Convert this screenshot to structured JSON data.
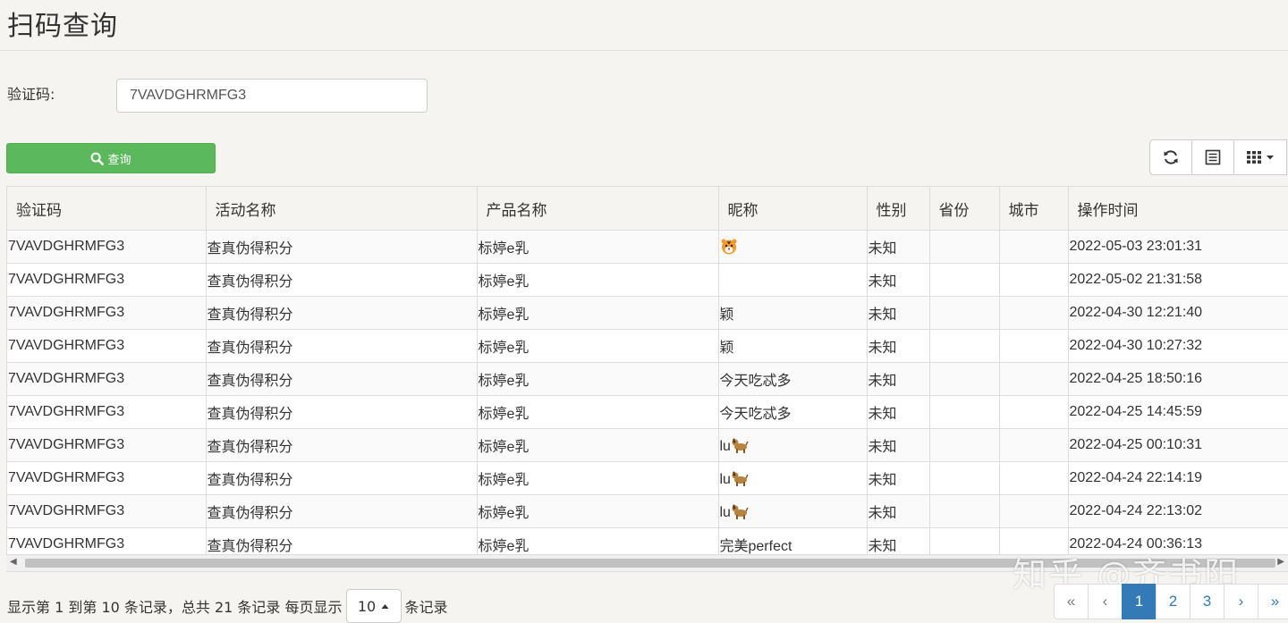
{
  "page": {
    "title": "扫码查询"
  },
  "search": {
    "label": "验证码:",
    "value": "7VAVDGHRMFG3",
    "button_label": "查询"
  },
  "toolbar": {
    "refresh_icon": "refresh-icon",
    "list_icon": "list-icon",
    "columns_icon": "columns-grid-icon"
  },
  "table": {
    "headers": [
      "验证码",
      "活动名称",
      "产品名称",
      "昵称",
      "性别",
      "省份",
      "城市",
      "操作时间"
    ],
    "rows": [
      {
        "code": "7VAVDGHRMFG3",
        "activity": "查真伪得积分",
        "product": "标婷e乳",
        "nickname": "",
        "nickname_icon": "tiger-emoji",
        "gender": "未知",
        "province": "",
        "city": "",
        "time": "2022-05-03 23:01:31"
      },
      {
        "code": "7VAVDGHRMFG3",
        "activity": "查真伪得积分",
        "product": "标婷e乳",
        "nickname": "",
        "nickname_icon": "",
        "gender": "未知",
        "province": "",
        "city": "",
        "time": "2022-05-02 21:31:58"
      },
      {
        "code": "7VAVDGHRMFG3",
        "activity": "查真伪得积分",
        "product": "标婷e乳",
        "nickname": "颖",
        "nickname_icon": "",
        "gender": "未知",
        "province": "",
        "city": "",
        "time": "2022-04-30 12:21:40"
      },
      {
        "code": "7VAVDGHRMFG3",
        "activity": "查真伪得积分",
        "product": "标婷e乳",
        "nickname": "颖",
        "nickname_icon": "",
        "gender": "未知",
        "province": "",
        "city": "",
        "time": "2022-04-30 10:27:32"
      },
      {
        "code": "7VAVDGHRMFG3",
        "activity": "查真伪得积分",
        "product": "标婷e乳",
        "nickname": "今天吃忒多",
        "nickname_icon": "",
        "gender": "未知",
        "province": "",
        "city": "",
        "time": "2022-04-25 18:50:16"
      },
      {
        "code": "7VAVDGHRMFG3",
        "activity": "查真伪得积分",
        "product": "标婷e乳",
        "nickname": "今天吃忒多",
        "nickname_icon": "",
        "gender": "未知",
        "province": "",
        "city": "",
        "time": "2022-04-25 14:45:59"
      },
      {
        "code": "7VAVDGHRMFG3",
        "activity": "查真伪得积分",
        "product": "标婷e乳",
        "nickname": "lu",
        "nickname_icon": "dog-emoji",
        "gender": "未知",
        "province": "",
        "city": "",
        "time": "2022-04-25 00:10:31"
      },
      {
        "code": "7VAVDGHRMFG3",
        "activity": "查真伪得积分",
        "product": "标婷e乳",
        "nickname": "lu",
        "nickname_icon": "dog-emoji",
        "gender": "未知",
        "province": "",
        "city": "",
        "time": "2022-04-24 22:14:19"
      },
      {
        "code": "7VAVDGHRMFG3",
        "activity": "查真伪得积分",
        "product": "标婷e乳",
        "nickname": "lu",
        "nickname_icon": "dog-emoji",
        "gender": "未知",
        "province": "",
        "city": "",
        "time": "2022-04-24 22:13:02"
      },
      {
        "code": "7VAVDGHRMFG3",
        "activity": "查真伪得积分",
        "product": "标婷e乳",
        "nickname": "完美perfect",
        "nickname_icon": "",
        "gender": "未知",
        "province": "",
        "city": "",
        "time": "2022-04-24 00:36:13"
      }
    ]
  },
  "footer": {
    "summary": "显示第 1 到第 10 条记录，总共 21 条记录 每页显示",
    "page_size": "10",
    "suffix": "条记录"
  },
  "pagination": {
    "first": "«",
    "prev": "‹",
    "pages": [
      "1",
      "2",
      "3"
    ],
    "active": "1",
    "next": "›",
    "last": "»"
  },
  "watermark": "知乎 @齐书阳",
  "colors": {
    "primary": "#337ab7",
    "success": "#5cb85c",
    "background": "#f5f4f0"
  }
}
